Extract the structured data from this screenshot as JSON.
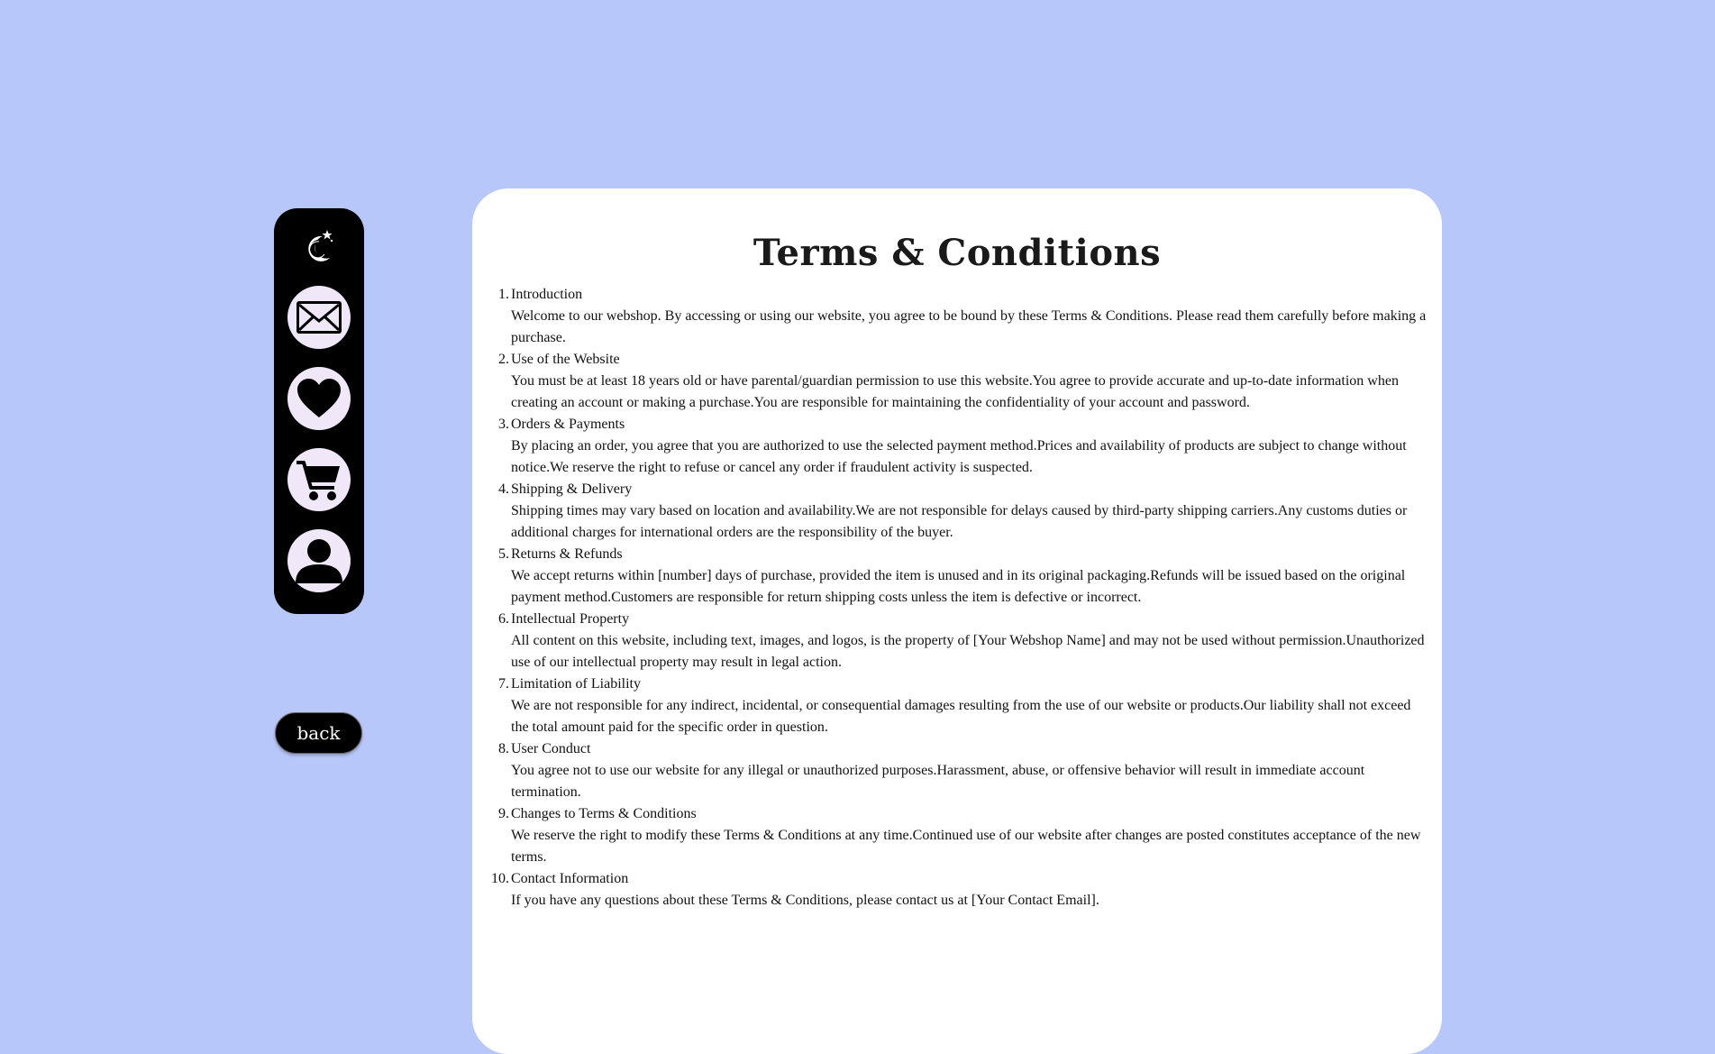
{
  "sidebar": {
    "items": [
      {
        "icon": "mail-icon"
      },
      {
        "icon": "heart-icon"
      },
      {
        "icon": "cart-icon"
      },
      {
        "icon": "user-icon"
      }
    ],
    "logo_icon": "moon-star-logo"
  },
  "back_label": "back",
  "title": "Terms & Conditions",
  "sections": [
    {
      "num": "1.",
      "heading": "Introduction",
      "body": "Welcome to our webshop. By accessing or using our website, you agree to be bound by these Terms & Conditions. Please read them carefully before making a purchase."
    },
    {
      "num": "2.",
      "heading": "Use of the Website",
      "body": "You must be at least 18 years old or have parental/guardian permission to use this website.You agree to provide accurate and up-to-date information when creating an account or making a purchase.You are responsible for maintaining the confidentiality of your account and password."
    },
    {
      "num": "3.",
      "heading": "Orders & Payments",
      "body": "By placing an order, you agree that you are authorized to use the selected payment method.Prices and availability of products are subject to change without notice.We reserve the right to refuse or cancel any order if fraudulent activity is suspected."
    },
    {
      "num": "4.",
      "heading": "Shipping & Delivery",
      "body": "Shipping times may vary based on location and availability.We are not responsible for delays caused by third-party shipping carriers.Any customs duties or additional charges for international orders are the responsibility of the buyer."
    },
    {
      "num": "5.",
      "heading": "Returns & Refunds",
      "body": "We accept returns within [number] days of purchase, provided the item is unused and in its original packaging.Refunds will be issued based on the original payment method.Customers are responsible for return shipping costs unless the item is defective or incorrect."
    },
    {
      "num": "6.",
      "heading": "Intellectual Property",
      "body": "All content on this website, including text, images, and logos, is the property of [Your Webshop Name] and may not be used without permission.Unauthorized use of our intellectual property may result in legal action."
    },
    {
      "num": "7.",
      "heading": "Limitation of Liability",
      "body": "We are not responsible for any indirect, incidental, or consequential damages resulting from the use of our website or products.Our liability shall not exceed the total amount paid for the specific order in question."
    },
    {
      "num": "8.",
      "heading": "User Conduct",
      "body": "You agree not to use our website for any illegal or unauthorized purposes.Harassment, abuse, or offensive behavior will result in immediate account termination."
    },
    {
      "num": "9.",
      "heading": "Changes to Terms & Conditions",
      "body": "We reserve the right to modify these Terms & Conditions at any time.Continued use of our website after changes are posted constitutes acceptance of the new terms."
    },
    {
      "num": "10.",
      "heading": "Contact Information",
      "body": "If you have any questions about these Terms & Conditions, please contact us at [Your Contact Email]."
    }
  ],
  "colors": {
    "background": "#b8c7f9",
    "sidebar": "#000000",
    "nav_circle": "#f0e8f8",
    "card": "#ffffff"
  }
}
